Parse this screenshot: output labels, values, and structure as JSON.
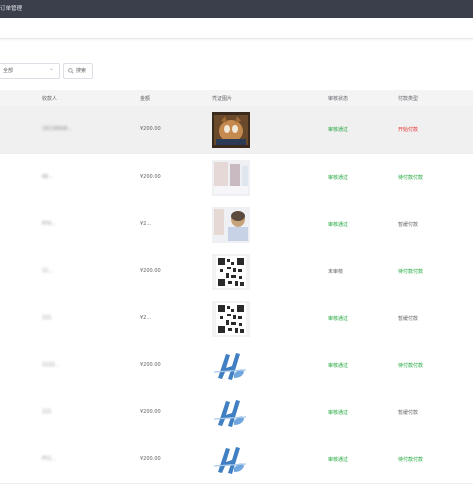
{
  "header": {
    "title": "订单管理"
  },
  "toolbar": {
    "filter_value": "全部",
    "search_label": "搜索"
  },
  "table": {
    "columns": [
      "收款人",
      "金额",
      "凭证图片",
      "审核状态",
      "付款类型"
    ],
    "rows": [
      {
        "payee": "18138668…",
        "amount": "¥200.00",
        "image": "photo-cat",
        "status": "审核通过",
        "status_kind": "ok",
        "pay": "开始付款",
        "pay_kind": "red"
      },
      {
        "payee": "66…",
        "amount": "¥200.00",
        "image": "photo-portrait",
        "status": "审核通过",
        "status_kind": "ok",
        "pay": "待付款付款",
        "pay_kind": "ok"
      },
      {
        "payee": "PY0…",
        "amount": "¥2…",
        "image": "photo-portrait2",
        "status": "审核通过",
        "status_kind": "ok",
        "pay": "暂缓付款",
        "pay_kind": "pend"
      },
      {
        "payee": "11…",
        "amount": "¥200.00",
        "image": "qr-code",
        "status": "未审核",
        "status_kind": "pend",
        "pay": "待付款付款",
        "pay_kind": "ok"
      },
      {
        "payee": "121",
        "amount": "¥2…",
        "image": "qr-code",
        "status": "审核通过",
        "status_kind": "ok",
        "pay": "暂缓付款",
        "pay_kind": "pend"
      },
      {
        "payee": "1122…",
        "amount": "¥200.00",
        "image": "logo-hb",
        "status": "审核通过",
        "status_kind": "ok",
        "pay": "待付款付款",
        "pay_kind": "ok"
      },
      {
        "payee": "121",
        "amount": "¥200.00",
        "image": "logo-hb",
        "status": "审核通过",
        "status_kind": "ok",
        "pay": "暂缓付款",
        "pay_kind": "pend"
      },
      {
        "payee": "PY2…",
        "amount": "¥200.00",
        "image": "logo-hb",
        "status": "审核通过",
        "status_kind": "ok",
        "pay": "待付款付款",
        "pay_kind": "ok"
      }
    ]
  },
  "colors": {
    "topbar": "#3b3f4c",
    "ok": "#1ea63a",
    "red": "#e3322e"
  }
}
